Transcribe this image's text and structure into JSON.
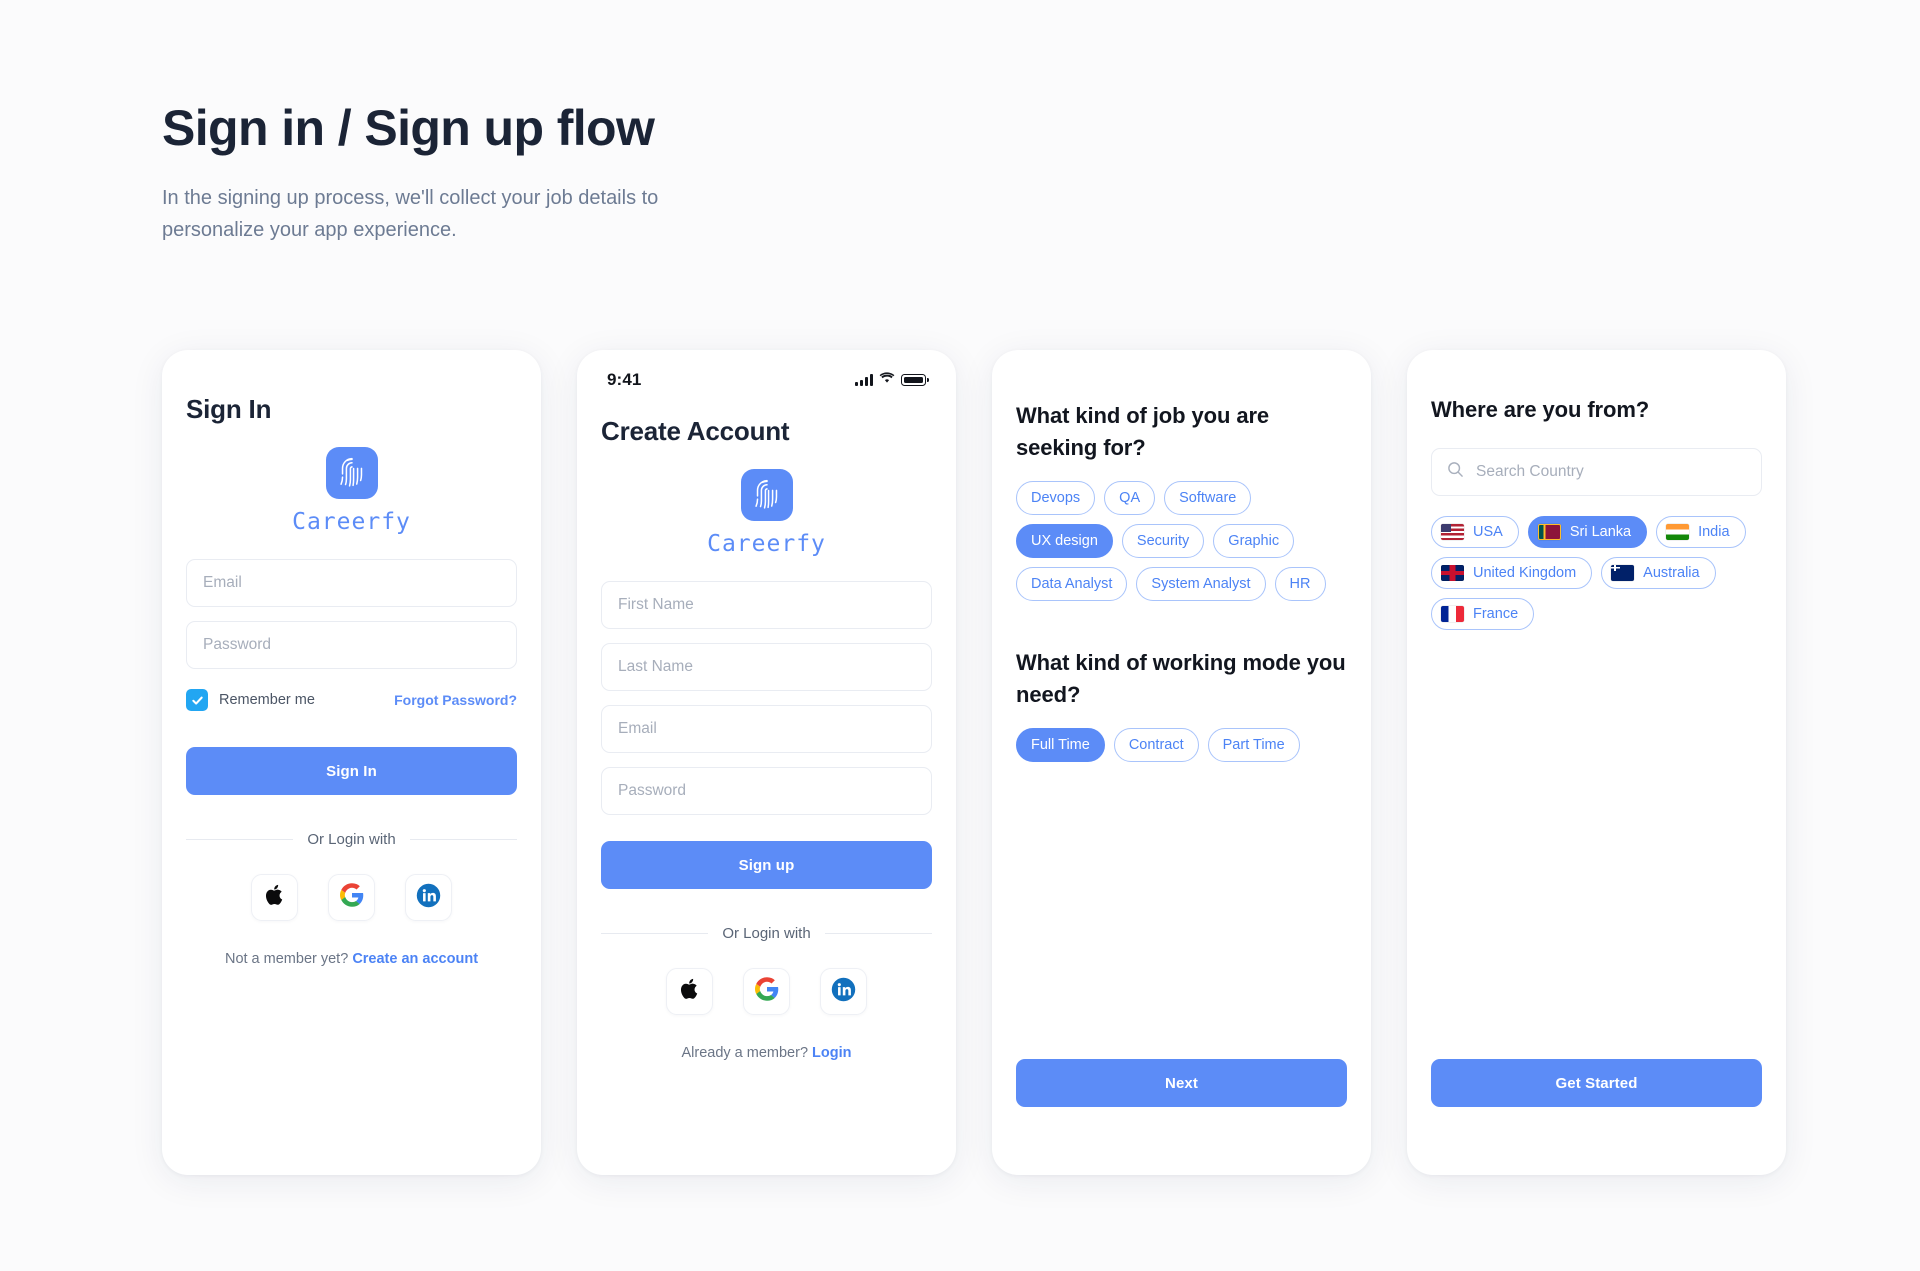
{
  "header": {
    "title": "Sign in / Sign up flow",
    "subtitle": "In the signing up process, we'll collect your job details to personalize your app experience."
  },
  "brand": {
    "name": "Careerfy",
    "logo_icon": "fingerprint-icon",
    "color": "#5c8cf7"
  },
  "colors": {
    "primary": "#5c8cf7",
    "chip_border": "#a9c4fb",
    "checkbox": "#22a6f2",
    "link": "#4c83f5",
    "page_bg": "#fbfbfc",
    "card_bg": "#ffffff",
    "title": "#1b2436",
    "subtitle": "#6d7b93",
    "placeholder": "#a7aebb"
  },
  "screen1": {
    "title": "Sign In",
    "email_placeholder": "Email",
    "email_value": "",
    "password_placeholder": "Password",
    "password_value": "",
    "remember_label": "Remember me",
    "remember_checked": true,
    "forgot_label": "Forgot Password?",
    "submit_label": "Sign In",
    "divider_label": "Or Login with",
    "socials": [
      "apple-icon",
      "google-icon",
      "linkedin-icon"
    ],
    "footer_text": "Not a member yet?",
    "footer_link": "Create an account"
  },
  "screen2": {
    "statusbar": {
      "time": "9:41",
      "icons": [
        "cellular-signal-icon",
        "wifi-icon",
        "battery-icon"
      ]
    },
    "title": "Create Account",
    "first_name_placeholder": "First Name",
    "first_name_value": "",
    "last_name_placeholder": "Last Name",
    "last_name_value": "",
    "email_placeholder": "Email",
    "email_value": "",
    "password_placeholder": "Password",
    "password_value": "",
    "submit_label": "Sign up",
    "divider_label": "Or Login with",
    "socials": [
      "apple-icon",
      "google-icon",
      "linkedin-icon"
    ],
    "footer_text": "Already a member?",
    "footer_link": "Login"
  },
  "screen3": {
    "question_1": "What kind of job you are seeking for?",
    "job_tags": [
      {
        "label": "Devops",
        "selected": false
      },
      {
        "label": "QA",
        "selected": false
      },
      {
        "label": "Software",
        "selected": false
      },
      {
        "label": "UX design",
        "selected": true
      },
      {
        "label": "Security",
        "selected": false
      },
      {
        "label": "Graphic",
        "selected": false
      },
      {
        "label": "Data Analyst",
        "selected": false
      },
      {
        "label": "System Analyst",
        "selected": false
      },
      {
        "label": "HR",
        "selected": false
      }
    ],
    "question_2": "What kind of working mode you need?",
    "mode_tags": [
      {
        "label": "Full Time",
        "selected": true
      },
      {
        "label": "Contract",
        "selected": false
      },
      {
        "label": "Part Time",
        "selected": false
      }
    ],
    "next_label": "Next"
  },
  "screen4": {
    "title": "Where are you from?",
    "search_placeholder": "Search Country",
    "search_value": "",
    "search_icon": "search-icon",
    "countries": [
      {
        "label": "USA",
        "flag": "🇺🇸",
        "selected": false
      },
      {
        "label": "Sri Lanka",
        "flag": "🇱🇰",
        "selected": true
      },
      {
        "label": "India",
        "flag": "🇮🇳",
        "selected": false
      },
      {
        "label": "United Kingdom",
        "flag": "🇬🇧",
        "selected": false
      },
      {
        "label": "Australia",
        "flag": "🇦🇺",
        "selected": false
      },
      {
        "label": "France",
        "flag": "🇫🇷",
        "selected": false
      }
    ],
    "cta_label": "Get Started"
  }
}
